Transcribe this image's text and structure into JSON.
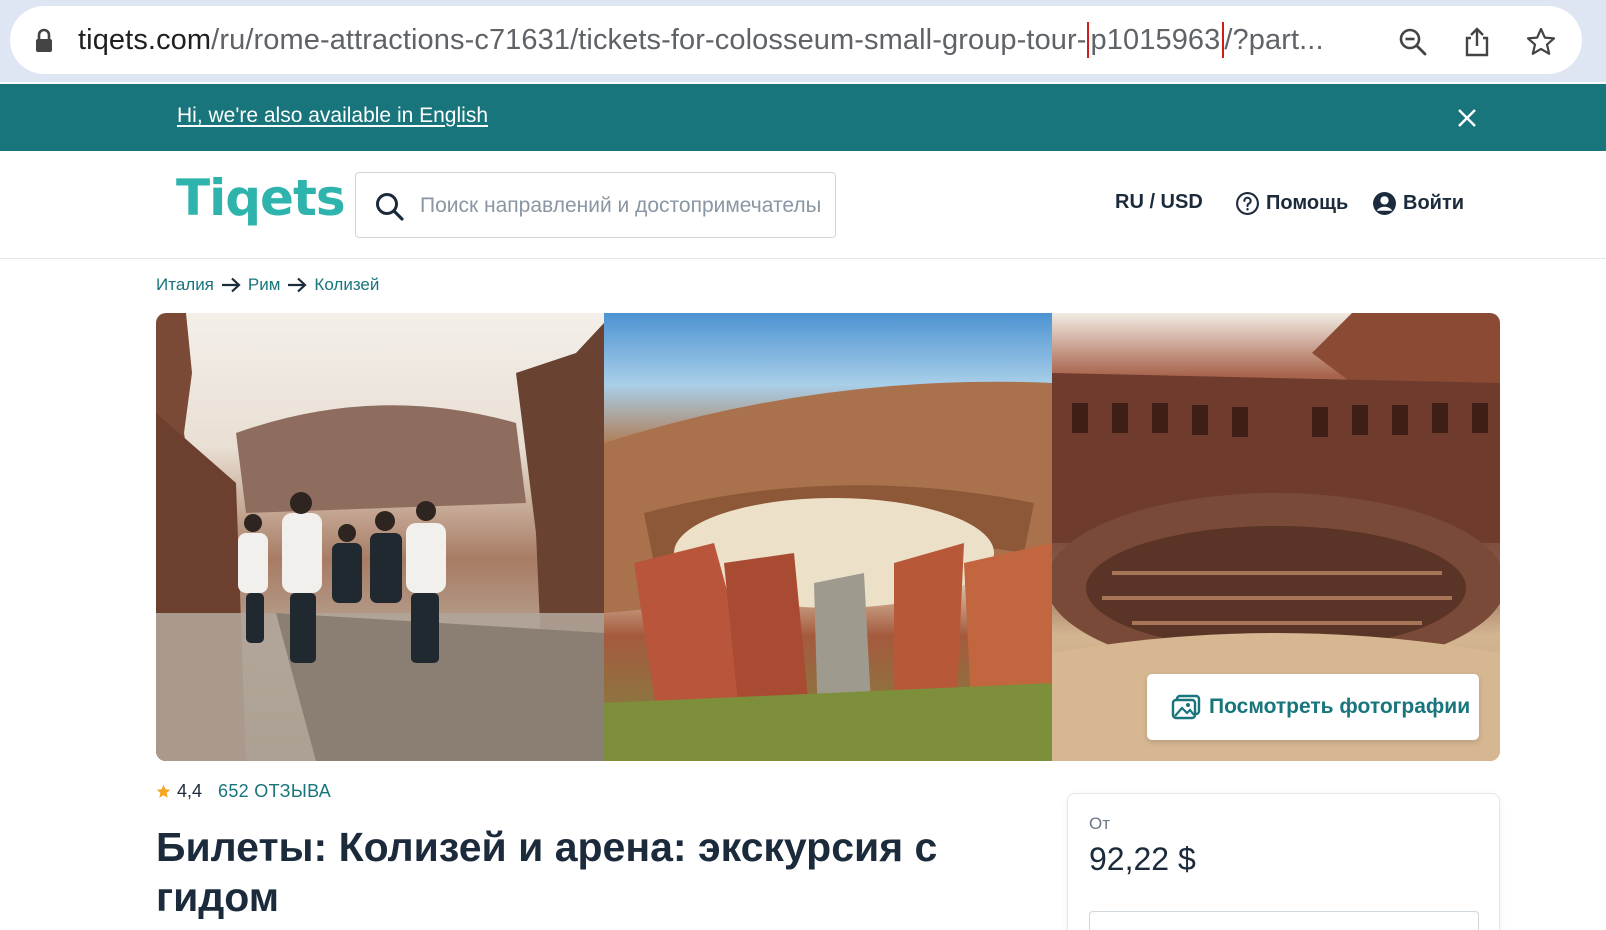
{
  "browser": {
    "url_host": "tiqets.com",
    "url_path_before": "/ru/rome-attractions-c71631/tickets-for-colosseum-small-group-tour-",
    "url_highlight": "p1015963",
    "url_path_after": "/?part..."
  },
  "banner": {
    "link_text": "Hi, we're also available in English"
  },
  "header": {
    "logo": "Tiqets",
    "search_placeholder": "Поиск направлений и достопримечательностей",
    "locale": "RU / USD",
    "help": "Помощь",
    "login": "Войти"
  },
  "breadcrumb": {
    "items": [
      "Италия",
      "Рим",
      "Колизей"
    ]
  },
  "gallery": {
    "button_label": "Посмотреть фотографии"
  },
  "rating": {
    "score": "4,4",
    "reviews": "652 ОТЗЫВА"
  },
  "product": {
    "title": "Билеты: Колизей и арена: экскурсия с гидом"
  },
  "price": {
    "from_label": "От",
    "value": "92,22 $"
  },
  "colors": {
    "brand_teal": "#17757b",
    "logo_teal": "#2fb4ad",
    "text_dark": "#1b2b3c",
    "highlight_red": "#d11a1a"
  }
}
